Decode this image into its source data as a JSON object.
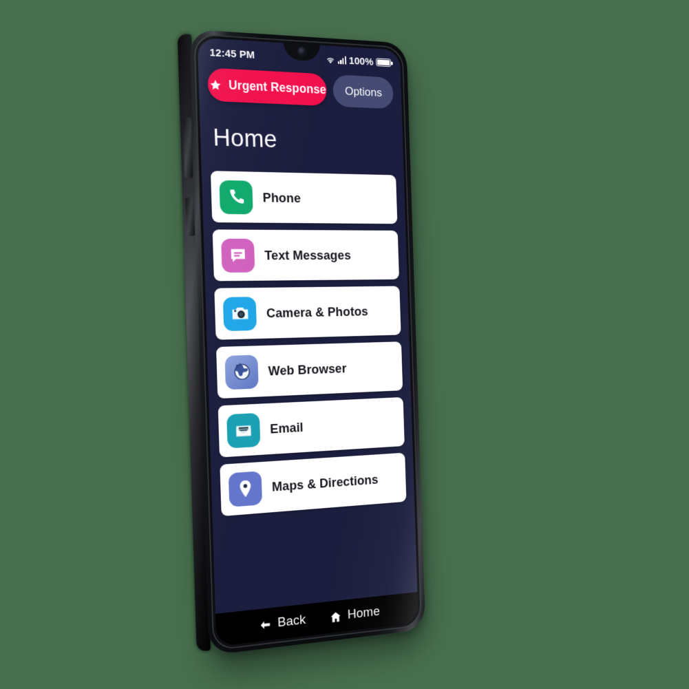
{
  "background_color": "#47704e",
  "device": {
    "name": "smartphone",
    "body_color": "#0b0c0e",
    "screen_background": "#1b1e3e"
  },
  "status_bar": {
    "time": "12:45 PM",
    "wifi_icon": "wifi-icon",
    "signal_icon": "cellular-signal-icon",
    "battery_percent": "100%",
    "battery_icon": "battery-full-icon"
  },
  "top_actions": {
    "urgent": {
      "label": "Urgent Response",
      "icon": "star-icon",
      "color": "#f2104c",
      "text_color": "#ffffff"
    },
    "options": {
      "label": "Options",
      "color": "#454b72",
      "text_color": "#ffffff"
    }
  },
  "page": {
    "title": "Home",
    "title_color": "#ffffff"
  },
  "app_list": [
    {
      "label": "Phone",
      "icon": "phone-handset-icon",
      "icon_color": "#10a96c"
    },
    {
      "label": "Text Messages",
      "icon": "chat-bubble-icon",
      "icon_color": "#d062be"
    },
    {
      "label": "Camera & Photos",
      "icon": "camera-icon",
      "icon_color": "#20a6e8"
    },
    {
      "label": "Web Browser",
      "icon": "globe-icon",
      "icon_color": "#7a90d2"
    },
    {
      "label": "Email",
      "icon": "envelope-icon",
      "icon_color": "#1ba0b4"
    },
    {
      "label": "Maps & Directions",
      "icon": "map-pin-icon",
      "icon_color": "#6577cc"
    }
  ],
  "nav_bar": {
    "background": "#000000",
    "items": [
      {
        "label": "Back",
        "icon": "arrow-left-icon"
      },
      {
        "label": "Home",
        "icon": "house-icon"
      }
    ]
  }
}
